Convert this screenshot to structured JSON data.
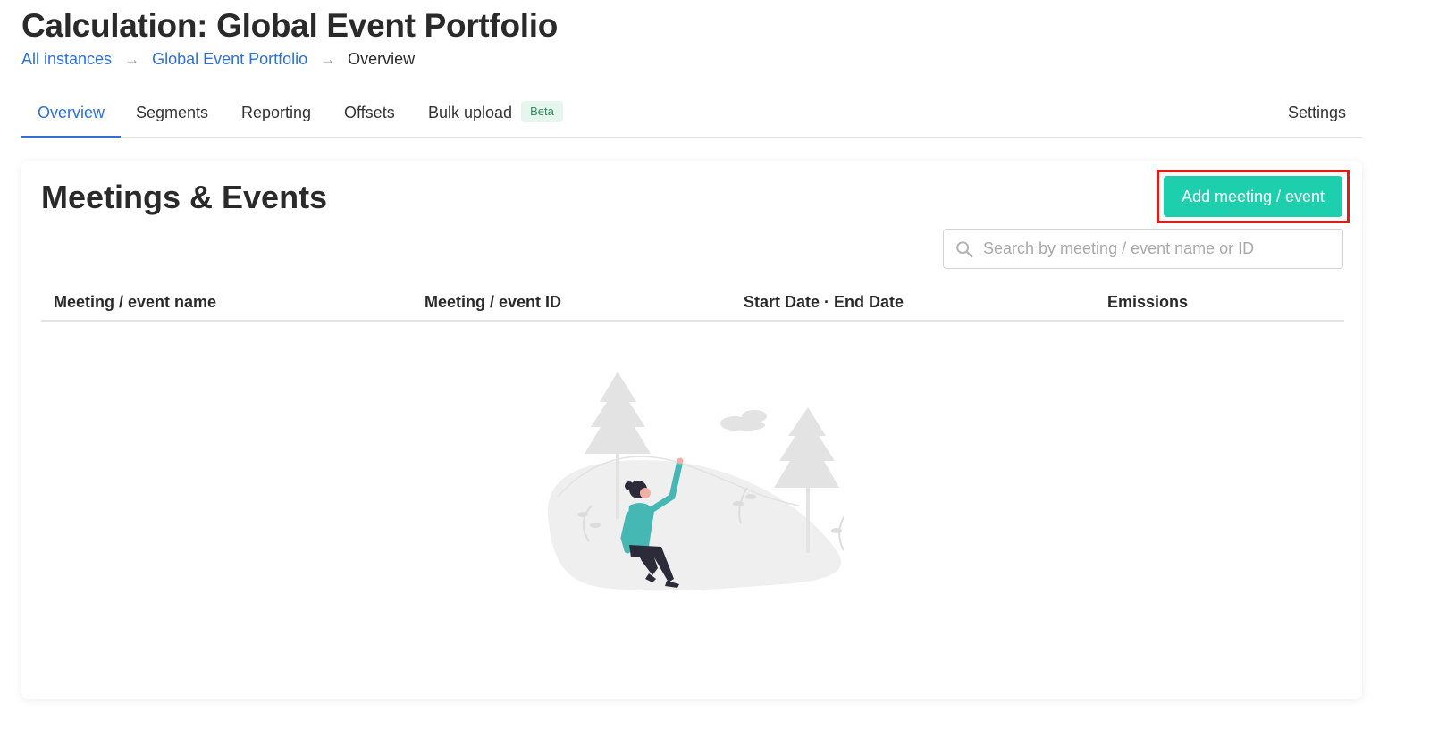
{
  "header": {
    "title": "Calculation: Global Event Portfolio",
    "breadcrumb": [
      {
        "label": "All instances",
        "link": true
      },
      {
        "label": "Global Event Portfolio",
        "link": true
      },
      {
        "label": "Overview",
        "link": false
      }
    ]
  },
  "tabs": [
    {
      "label": "Overview",
      "active": true
    },
    {
      "label": "Segments",
      "active": false
    },
    {
      "label": "Reporting",
      "active": false
    },
    {
      "label": "Offsets",
      "active": false
    },
    {
      "label": "Bulk upload",
      "active": false,
      "badge": "Beta"
    },
    {
      "label": "Settings",
      "active": false
    }
  ],
  "card": {
    "title": "Meetings & Events",
    "add_button_label": "Add meeting / event",
    "search": {
      "placeholder": "Search by meeting / event name or ID",
      "value": ""
    },
    "table": {
      "columns": [
        "Meeting / event name",
        "Meeting / event ID",
        "Start Date · End Date",
        "Emissions"
      ],
      "rows": []
    }
  },
  "colors": {
    "accent": "#2f6fd6",
    "primary_button": "#1dcfac",
    "highlight": "#e31b12",
    "beta_badge_bg": "#e6f6ef",
    "beta_badge_text": "#2d8a5a"
  },
  "icons": {
    "breadcrumb_separator": "arrow-right-icon",
    "search": "search-icon",
    "empty_state": "empty-state-illustration"
  }
}
